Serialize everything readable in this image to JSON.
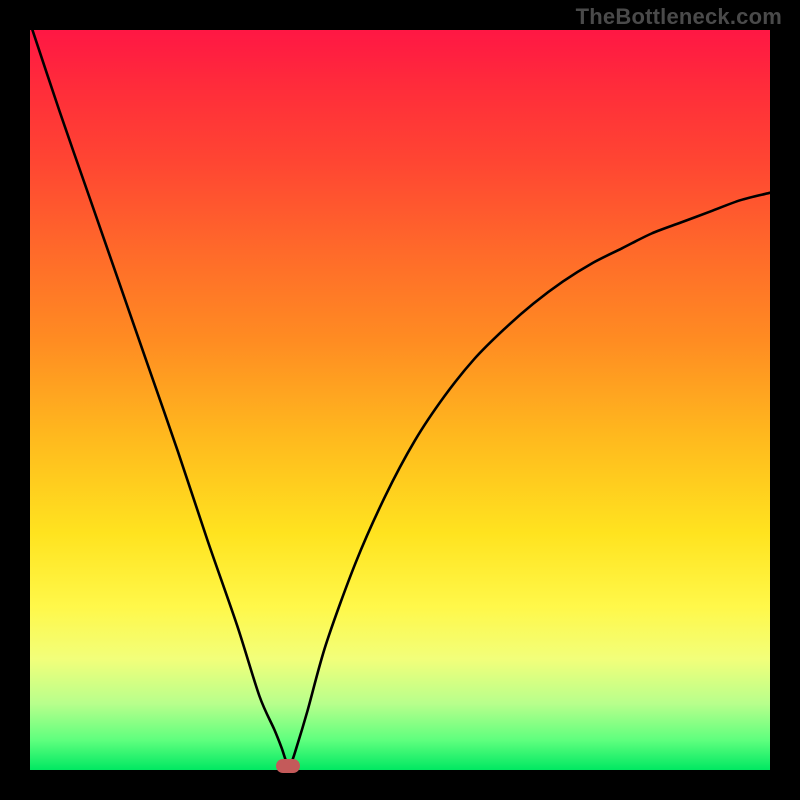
{
  "watermark": "TheBottleneck.com",
  "chart_data": {
    "type": "line",
    "title": "",
    "xlabel": "",
    "ylabel": "",
    "xlim": [
      0,
      100
    ],
    "ylim": [
      0,
      100
    ],
    "grid": false,
    "legend": false,
    "series": [
      {
        "name": "bottleneck-curve",
        "x": [
          0,
          4,
          8,
          12,
          16,
          20,
          24,
          28,
          31,
          33,
          34,
          34.7,
          35.3,
          36,
          37.5,
          40,
          44,
          48,
          52,
          56,
          60,
          64,
          68,
          72,
          76,
          80,
          84,
          88,
          92,
          96,
          100
        ],
        "y": [
          101,
          89,
          77.5,
          66,
          54.5,
          43,
          31,
          19.5,
          10,
          5.5,
          3,
          1,
          1,
          3,
          8,
          17,
          28,
          37,
          44.5,
          50.5,
          55.5,
          59.5,
          63,
          66,
          68.5,
          70.5,
          72.5,
          74,
          75.5,
          77,
          78
        ]
      }
    ],
    "marker": {
      "x": 34.9,
      "y": 0,
      "color": "#c45a5a"
    },
    "gradient_stops": [
      {
        "pos": 0,
        "color": "#ff1744"
      },
      {
        "pos": 8,
        "color": "#ff2d3a"
      },
      {
        "pos": 18,
        "color": "#ff4632"
      },
      {
        "pos": 30,
        "color": "#ff6a2a"
      },
      {
        "pos": 42,
        "color": "#ff8c22"
      },
      {
        "pos": 55,
        "color": "#ffb91e"
      },
      {
        "pos": 68,
        "color": "#ffe31f"
      },
      {
        "pos": 78,
        "color": "#fff84a"
      },
      {
        "pos": 85,
        "color": "#f2ff7a"
      },
      {
        "pos": 91,
        "color": "#b8ff8c"
      },
      {
        "pos": 96,
        "color": "#5eff7e"
      },
      {
        "pos": 100,
        "color": "#00e862"
      }
    ]
  }
}
